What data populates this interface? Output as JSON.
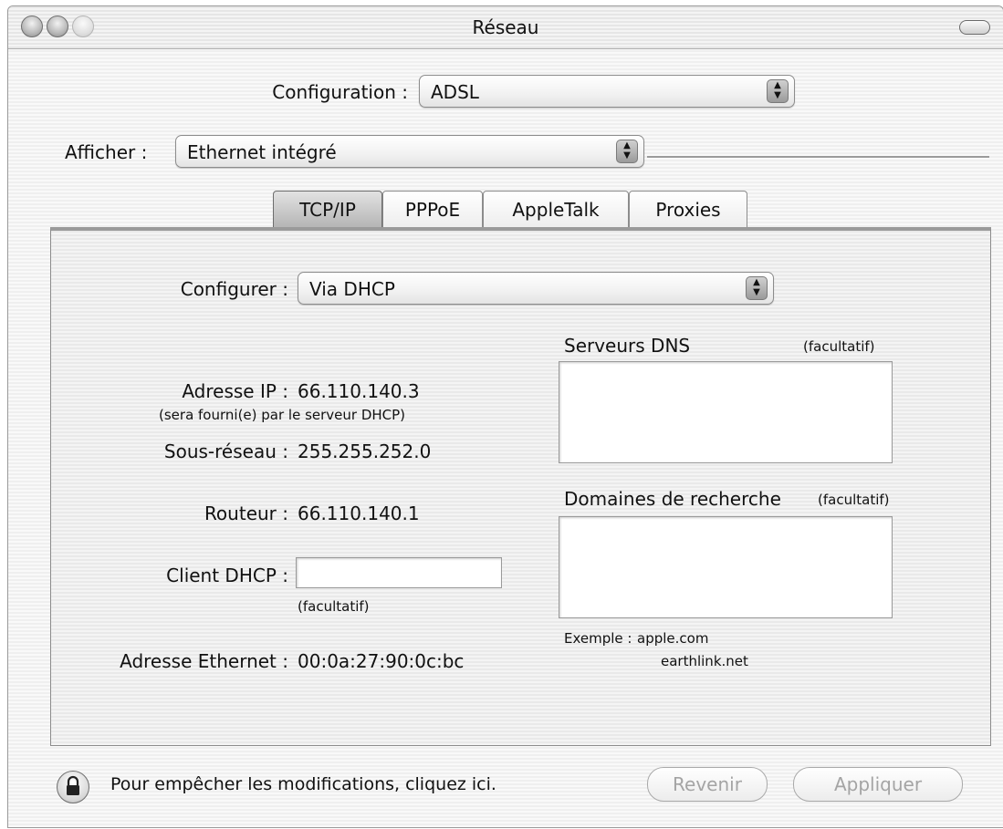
{
  "window": {
    "title": "Réseau"
  },
  "configuration": {
    "label": "Configuration :",
    "value": "ADSL"
  },
  "afficher": {
    "label": "Afficher :",
    "value": "Ethernet intégré"
  },
  "tabs": [
    {
      "label": "TCP/IP",
      "active": true
    },
    {
      "label": "PPPoE",
      "active": false
    },
    {
      "label": "AppleTalk",
      "active": false
    },
    {
      "label": "Proxies",
      "active": false
    }
  ],
  "tcpip": {
    "configurer": {
      "label": "Configurer :",
      "value": "Via DHCP"
    },
    "ip": {
      "label": "Adresse IP :",
      "value": "66.110.140.3",
      "note": "(sera fourni(e) par le serveur DHCP)"
    },
    "subnet": {
      "label": "Sous-réseau :",
      "value": "255.255.252.0"
    },
    "router": {
      "label": "Routeur :",
      "value": "66.110.140.1"
    },
    "dhcp_client": {
      "label": "Client DHCP :",
      "value": "",
      "note": "(facultatif)"
    },
    "ethernet": {
      "label": "Adresse Ethernet :",
      "value": "00:0a:27:90:0c:bc"
    },
    "dns": {
      "label": "Serveurs DNS",
      "optional": "(facultatif)",
      "value": ""
    },
    "search": {
      "label": "Domaines de recherche",
      "optional": "(facultatif)",
      "value": ""
    },
    "example": {
      "label": "Exemple :",
      "line1": "apple.com",
      "line2": "earthlink.net"
    }
  },
  "footer": {
    "lock_text": "Pour empêcher les modifications, cliquez ici.",
    "revert": "Revenir",
    "apply": "Appliquer"
  }
}
